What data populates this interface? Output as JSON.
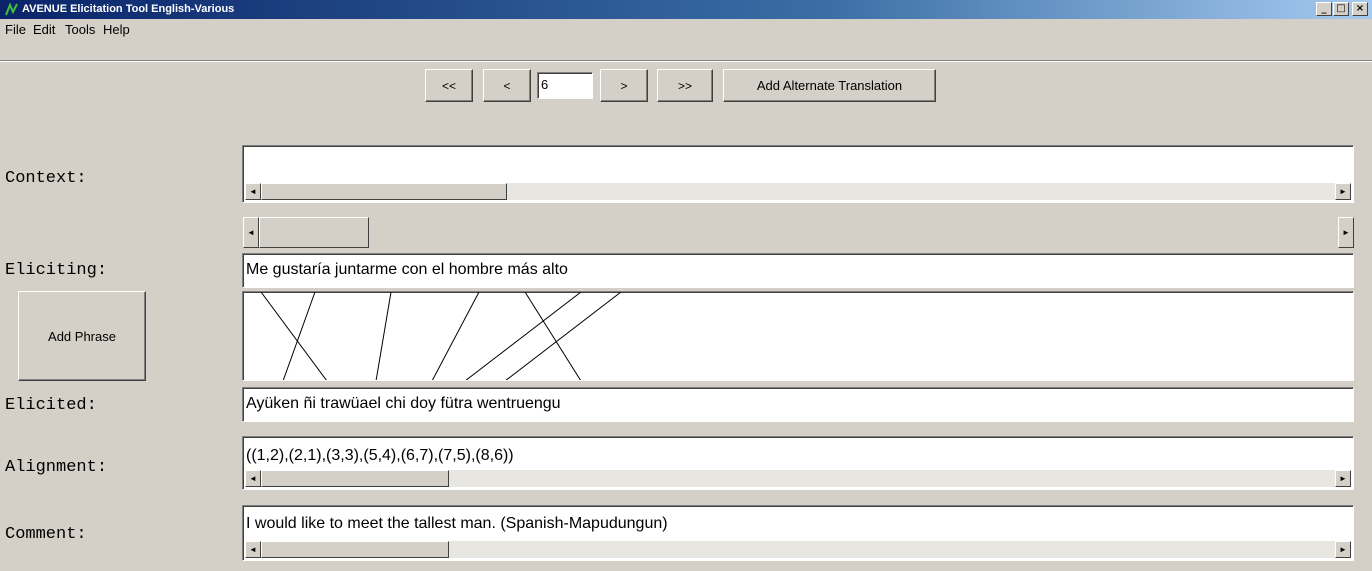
{
  "window": {
    "title": "AVENUE Elicitation Tool English-Various",
    "minimize_glyph": "_",
    "maximize_glyph": "□",
    "close_glyph": "×"
  },
  "menu": {
    "file": "File",
    "edit": "Edit",
    "tools": "Tools",
    "help": "Help"
  },
  "nav": {
    "first_label": "<<",
    "prev_label": "<",
    "page_value": "6",
    "next_label": ">",
    "last_label": ">>",
    "add_alt_label": "Add Alternate Translation"
  },
  "labels": {
    "context": "Context:",
    "eliciting": "Eliciting:",
    "elicited": "Elicited:",
    "alignment": "Alignment:",
    "comment": "Comment:"
  },
  "add_phrase_label": "Add Phrase",
  "fields": {
    "context": "",
    "eliciting": "Me gustaría juntarme con el hombre más alto",
    "elicited": "Ayüken ñi trawüael chi doy fütra wentruengu",
    "alignment": "((1,2),(2,1),(3,3),(5,4),(6,7),(7,5),(8,6))",
    "comment": "I would like to meet the tallest man. (Spanish-Mapudungun)"
  },
  "icons": {
    "scroll_left": "◄",
    "scroll_right": "►"
  },
  "colors": {
    "window_bg": "#d4d0c8",
    "titlebar": "#0a246a"
  }
}
